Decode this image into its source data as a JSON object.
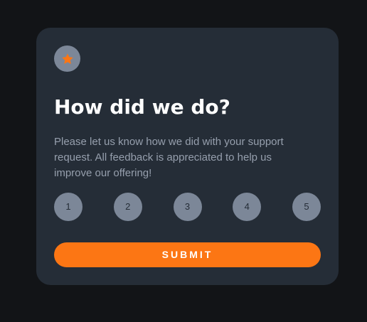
{
  "card": {
    "icon": "star-icon",
    "title": "How did we do?",
    "description": "Please let us know how we did with your support request. All feedback is appreciated to help us improve our offering!",
    "ratings": [
      "1",
      "2",
      "3",
      "4",
      "5"
    ],
    "submit_label": "SUBMIT"
  },
  "colors": {
    "page_background": "#121417",
    "card_background": "#252d37",
    "accent": "#fc7614",
    "rating_background": "#7c8798",
    "text_muted": "#969fad",
    "text_primary": "#ffffff"
  }
}
